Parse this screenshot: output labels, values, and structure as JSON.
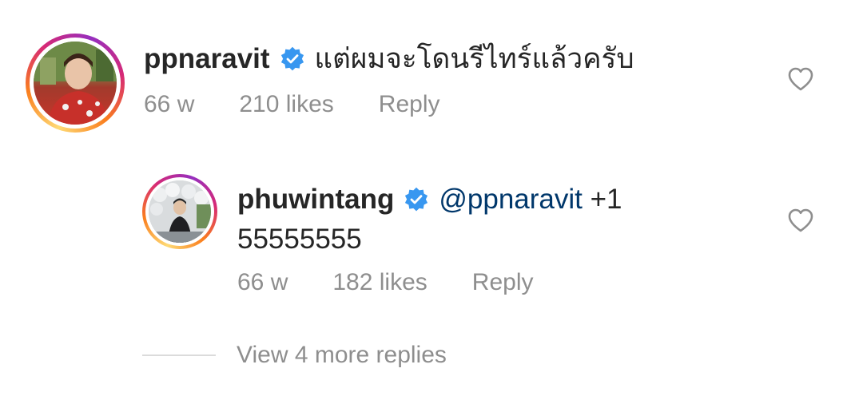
{
  "comments": [
    {
      "username": "ppnaravit",
      "text": "แต่ผมจะโดนรีไทร์แล้วครับ",
      "time": "66 w",
      "likes": "210 likes",
      "reply_label": "Reply",
      "verified": true
    },
    {
      "username": "phuwintang",
      "mention": "@ppnaravit",
      "text_after_mention": " +1",
      "second_line": "55555555",
      "time": "66 w",
      "likes": "182 likes",
      "reply_label": "Reply",
      "verified": true
    }
  ],
  "view_more_replies": "View 4 more replies",
  "colors": {
    "verified_badge": "#3897f0",
    "mention": "#00376b",
    "meta_text": "#8e8e8e",
    "primary_text": "#262626"
  },
  "icons": {
    "verified": "verified-badge-icon",
    "like": "heart-outline-icon"
  }
}
